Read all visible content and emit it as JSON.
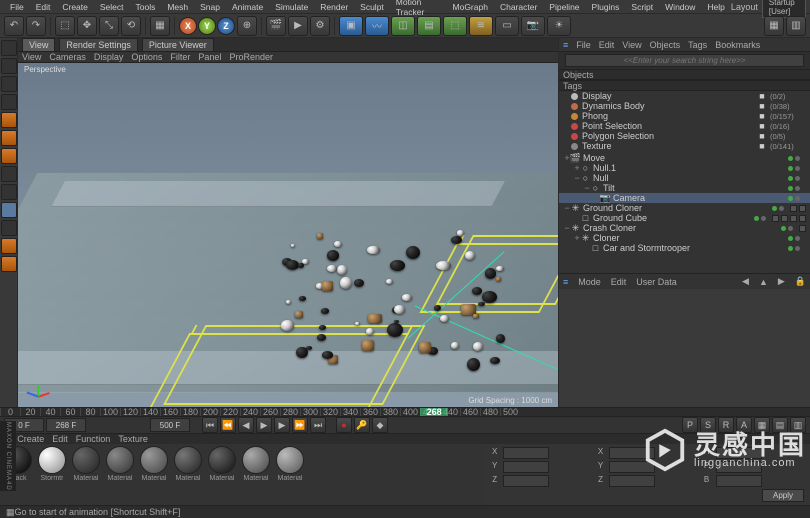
{
  "menubar": {
    "items": [
      "File",
      "Edit",
      "Create",
      "Select",
      "Tools",
      "Mesh",
      "Snap",
      "Animate",
      "Simulate",
      "Render",
      "Sculpt",
      "Motion Tracker",
      "MoGraph",
      "Character",
      "Pipeline",
      "Plugins",
      "Script",
      "Window",
      "Help"
    ],
    "layout_label": "Layout",
    "layout_value": "Startup [User]"
  },
  "toolbar_icons": [
    {
      "name": "undo-icon",
      "glyph": "↶"
    },
    {
      "name": "redo-icon",
      "glyph": "↷"
    }
  ],
  "axes": {
    "x": "X",
    "y": "Y",
    "z": "Z"
  },
  "view_tabs": [
    "View",
    "Render Settings",
    "Picture Viewer"
  ],
  "view_menu": [
    "View",
    "Cameras",
    "Display",
    "Options",
    "Filter",
    "Panel",
    "ProRender"
  ],
  "viewport": {
    "label": "Perspective",
    "grid_spacing": "Grid Spacing : 1000 cm"
  },
  "left_icons": [
    {
      "name": "live-select-icon",
      "cls": ""
    },
    {
      "name": "model-mode-icon",
      "cls": ""
    },
    {
      "name": "texture-mode-icon",
      "cls": ""
    },
    {
      "name": "workplane-icon",
      "cls": ""
    },
    {
      "name": "point-mode-icon",
      "cls": "or"
    },
    {
      "name": "edge-mode-icon",
      "cls": "or"
    },
    {
      "name": "poly-mode-icon",
      "cls": "or"
    },
    {
      "name": "axis-l-icon",
      "cls": ""
    },
    {
      "name": "enable-axis-icon",
      "cls": ""
    },
    {
      "name": "viewport-solo-icon",
      "cls": "sel"
    },
    {
      "name": "snap-icon",
      "cls": ""
    },
    {
      "name": "locked-workplane-icon",
      "cls": "or"
    },
    {
      "name": "planar-workplane-icon",
      "cls": "or"
    }
  ],
  "right_panel": {
    "top_menu": [
      "File",
      "Edit",
      "View",
      "Objects",
      "Tags",
      "Bookmarks"
    ],
    "search_placeholder": "<<Enter your search string here>>",
    "objects_label": "Objects",
    "tags_label": "Tags",
    "tags": [
      {
        "name": "Display",
        "color": "#bbbbbb",
        "count": "(0/2)"
      },
      {
        "name": "Dynamics Body",
        "color": "#c06a4a",
        "count": "(0/38)"
      },
      {
        "name": "Phong",
        "color": "#c08a3a",
        "count": "(0/157)"
      },
      {
        "name": "Point Selection",
        "color": "#c24a4a",
        "count": "(0/16)"
      },
      {
        "name": "Polygon Selection",
        "color": "#c24a4a",
        "count": "(0/5)"
      },
      {
        "name": "Texture",
        "color": "#888888",
        "count": "(0/141)"
      }
    ],
    "tree": [
      {
        "depth": 0,
        "tog": "+",
        "icon": "🎬",
        "name": "Move",
        "tags": 0,
        "sel": false
      },
      {
        "depth": 1,
        "tog": "+",
        "icon": "○",
        "name": "Null.1",
        "tags": 0,
        "sel": false
      },
      {
        "depth": 1,
        "tog": "−",
        "icon": "○",
        "name": "Null",
        "tags": 0,
        "sel": false
      },
      {
        "depth": 2,
        "tog": "−",
        "icon": "○",
        "name": "Tilt",
        "tags": 0,
        "sel": false
      },
      {
        "depth": 3,
        "tog": "",
        "icon": "📷",
        "name": "Camera",
        "tags": 0,
        "sel": true
      },
      {
        "depth": 0,
        "tog": "−",
        "icon": "✳",
        "name": "Ground Cloner",
        "tags": 2,
        "sel": false
      },
      {
        "depth": 1,
        "tog": "",
        "icon": "□",
        "name": "Ground Cube",
        "tags": 4,
        "sel": false
      },
      {
        "depth": 0,
        "tog": "−",
        "icon": "✳",
        "name": "Crash Cloner",
        "tags": 1,
        "sel": false
      },
      {
        "depth": 1,
        "tog": "+",
        "icon": "✳",
        "name": "Cloner",
        "tags": 0,
        "sel": false
      },
      {
        "depth": 2,
        "tog": "",
        "icon": "□",
        "name": "Car and Stormtrooper",
        "tags": 0,
        "sel": false
      }
    ],
    "attr_menu": [
      "Mode",
      "Edit",
      "User Data"
    ]
  },
  "timeline": {
    "ticks": [
      "0",
      "20",
      "40",
      "60",
      "80",
      "100",
      "120",
      "140",
      "160",
      "180",
      "200",
      "220",
      "240",
      "260",
      "280",
      "300",
      "320",
      "340",
      "360",
      "380",
      "400",
      "420",
      "440",
      "460",
      "480",
      "500"
    ],
    "current": "268",
    "start": "0 F",
    "curframe": "268 F",
    "end": "500 F"
  },
  "material_menu": [
    "Create",
    "Edit",
    "Function",
    "Texture"
  ],
  "materials": [
    {
      "name": "Black",
      "bg": "radial-gradient(circle at 30% 30%,#555,#000)"
    },
    {
      "name": "Stormtr",
      "bg": "radial-gradient(circle at 30% 30%,#fff,#888)"
    },
    {
      "name": "Material",
      "bg": "radial-gradient(circle at 30% 30%,#666,#222)"
    },
    {
      "name": "Material",
      "bg": "radial-gradient(circle at 30% 30%,#888,#333)"
    },
    {
      "name": "Material",
      "bg": "radial-gradient(circle at 30% 30%,#999,#444)"
    },
    {
      "name": "Material",
      "bg": "radial-gradient(circle at 30% 30%,#777,#222)"
    },
    {
      "name": "Material",
      "bg": "radial-gradient(circle at 30% 30%,#666,#111)"
    },
    {
      "name": "Material",
      "bg": "radial-gradient(circle at 30% 30%,#aaa,#444)"
    },
    {
      "name": "Material",
      "bg": "radial-gradient(circle at 30% 30%,#bbb,#555)"
    }
  ],
  "coords": {
    "headers": [
      "",
      "X",
      "Y",
      "Z"
    ],
    "pos_label": "X",
    "size_label": "X",
    "rot_label": "H",
    "r2": [
      "Y",
      "Y",
      "P"
    ],
    "r3": [
      "Z",
      "Z",
      "B"
    ],
    "apply": "Apply"
  },
  "status": "Go to start of animation [Shortcut Shift+F]",
  "watermark": {
    "cn": "灵感中国",
    "en": "lingganchina.com"
  },
  "sidebadge": "MAXON CINEMA4D"
}
